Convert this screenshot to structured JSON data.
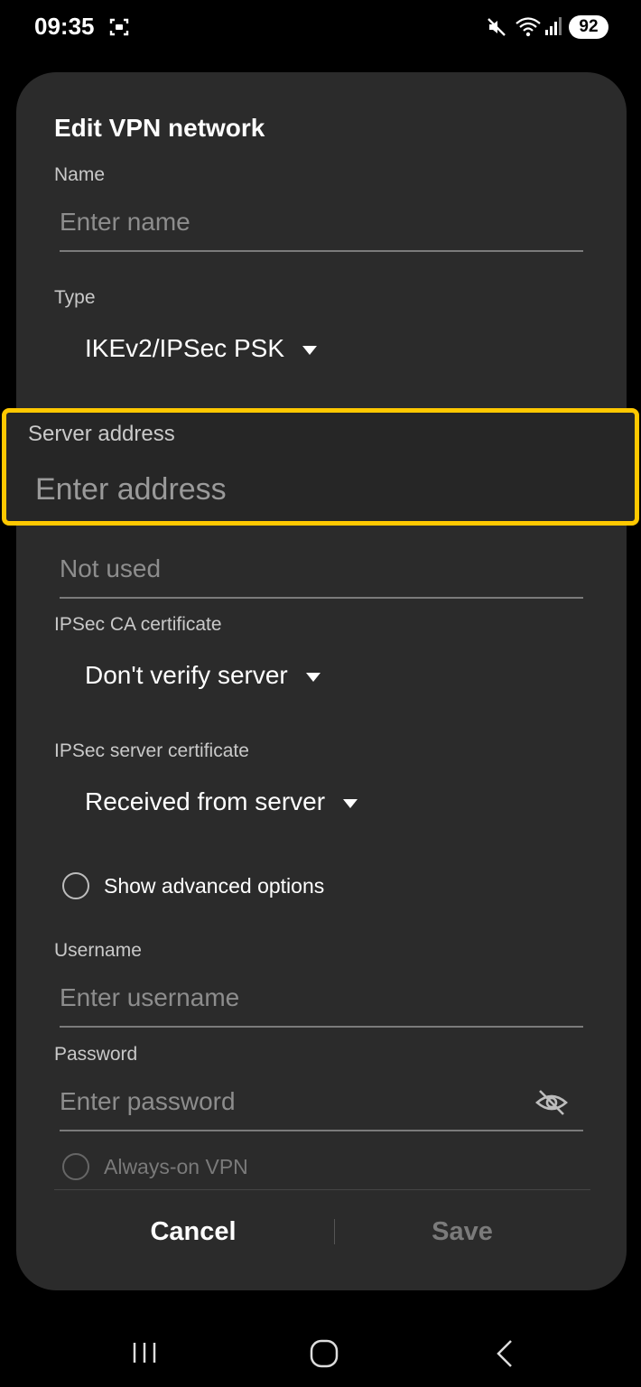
{
  "status_bar": {
    "time": "09:35",
    "battery": "92",
    "icons": [
      "screen-record-icon",
      "mute-icon",
      "wifi-icon",
      "signal-icon"
    ]
  },
  "dialog": {
    "title": "Edit VPN network",
    "name": {
      "label": "Name",
      "placeholder": "Enter name"
    },
    "type": {
      "label": "Type",
      "value": "IKEv2/IPSec PSK"
    },
    "server_address": {
      "label": "Server address",
      "placeholder": "Enter address"
    },
    "ipsec_identifier": {
      "placeholder": "Not used"
    },
    "ipsec_ca_certificate": {
      "label": "IPSec CA certificate",
      "value": "Don't verify server"
    },
    "ipsec_server_certificate": {
      "label": "IPSec server certificate",
      "value": "Received from server"
    },
    "show_advanced": {
      "label": "Show advanced options"
    },
    "username": {
      "label": "Username",
      "placeholder": "Enter username"
    },
    "password": {
      "label": "Password",
      "placeholder": "Enter password"
    },
    "always_on": {
      "label": "Always-on VPN"
    },
    "buttons": {
      "cancel": "Cancel",
      "save": "Save"
    }
  },
  "colors": {
    "highlight": "#ffc800",
    "dialog_bg": "#2b2b2b",
    "background": "#000000"
  }
}
